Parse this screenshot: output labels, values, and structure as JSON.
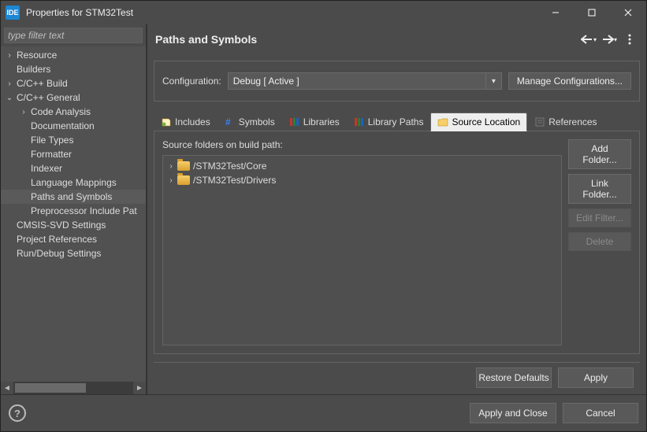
{
  "window": {
    "appIcon": "IDE",
    "title": "Properties for STM32Test"
  },
  "filter": {
    "placeholder": "type filter text"
  },
  "tree": [
    {
      "label": "Resource",
      "depth": 0,
      "twisty": ">"
    },
    {
      "label": "Builders",
      "depth": 0,
      "twisty": ""
    },
    {
      "label": "C/C++ Build",
      "depth": 0,
      "twisty": ">"
    },
    {
      "label": "C/C++ General",
      "depth": 0,
      "twisty": "v"
    },
    {
      "label": "Code Analysis",
      "depth": 1,
      "twisty": ">"
    },
    {
      "label": "Documentation",
      "depth": 1,
      "twisty": ""
    },
    {
      "label": "File Types",
      "depth": 1,
      "twisty": ""
    },
    {
      "label": "Formatter",
      "depth": 1,
      "twisty": ""
    },
    {
      "label": "Indexer",
      "depth": 1,
      "twisty": ""
    },
    {
      "label": "Language Mappings",
      "depth": 1,
      "twisty": ""
    },
    {
      "label": "Paths and Symbols",
      "depth": 1,
      "twisty": "",
      "selected": true
    },
    {
      "label": "Preprocessor Include Pat",
      "depth": 1,
      "twisty": ""
    },
    {
      "label": "CMSIS-SVD Settings",
      "depth": 0,
      "twisty": ""
    },
    {
      "label": "Project References",
      "depth": 0,
      "twisty": ""
    },
    {
      "label": "Run/Debug Settings",
      "depth": 0,
      "twisty": ""
    }
  ],
  "header": {
    "title": "Paths and Symbols"
  },
  "config": {
    "label": "Configuration:",
    "value": "Debug  [ Active ]",
    "manage": "Manage Configurations..."
  },
  "tabs": [
    {
      "label": "Includes",
      "icon": "includes"
    },
    {
      "label": "Symbols",
      "icon": "symbols"
    },
    {
      "label": "Libraries",
      "icon": "libraries"
    },
    {
      "label": "Library Paths",
      "icon": "libpaths"
    },
    {
      "label": "Source Location",
      "icon": "source",
      "active": true
    },
    {
      "label": "References",
      "icon": "references"
    }
  ],
  "source": {
    "label": "Source folders on build path:",
    "items": [
      "/STM32Test/Core",
      "/STM32Test/Drivers"
    ],
    "buttons": {
      "add": "Add Folder...",
      "link": "Link Folder...",
      "edit": "Edit Filter...",
      "delete": "Delete"
    }
  },
  "bottom": {
    "restore": "Restore Defaults",
    "apply": "Apply"
  },
  "footer": {
    "applyClose": "Apply and Close",
    "cancel": "Cancel"
  }
}
